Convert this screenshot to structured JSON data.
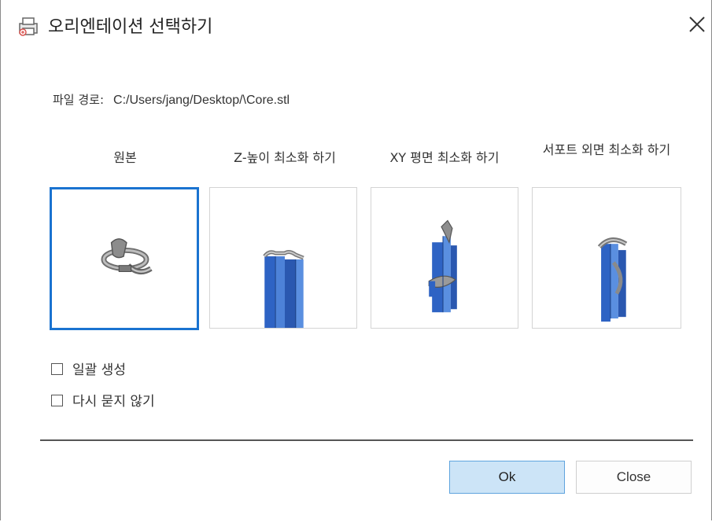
{
  "window": {
    "title": "오리엔테이션 선택하기",
    "app_icon": "printer-icon",
    "close_icon": "close-icon"
  },
  "file_path": {
    "label": "파일 경로:",
    "value": "C:/Users/jang/Desktop/\\Core.stl"
  },
  "orientation_options": [
    {
      "label": "원본",
      "selected": true,
      "preview": "original-model-preview"
    },
    {
      "label": "Z-높이 최소화 하기",
      "selected": false,
      "preview": "z-height-model-preview"
    },
    {
      "label": "XY 평면 최소화 하기",
      "selected": false,
      "preview": "xy-plane-model-preview"
    },
    {
      "label": "서포트 외면 최소화 하기",
      "selected": false,
      "preview": "support-surface-model-preview"
    }
  ],
  "checkboxes": [
    {
      "label": "일괄 생성",
      "checked": false
    },
    {
      "label": "다시 묻지 않기",
      "checked": false
    }
  ],
  "buttons": {
    "ok": "Ok",
    "close": "Close"
  },
  "colors": {
    "selection_border": "#1a73d0",
    "ok_button_bg": "#cce4f7",
    "model_blue": "#2e63c4"
  }
}
